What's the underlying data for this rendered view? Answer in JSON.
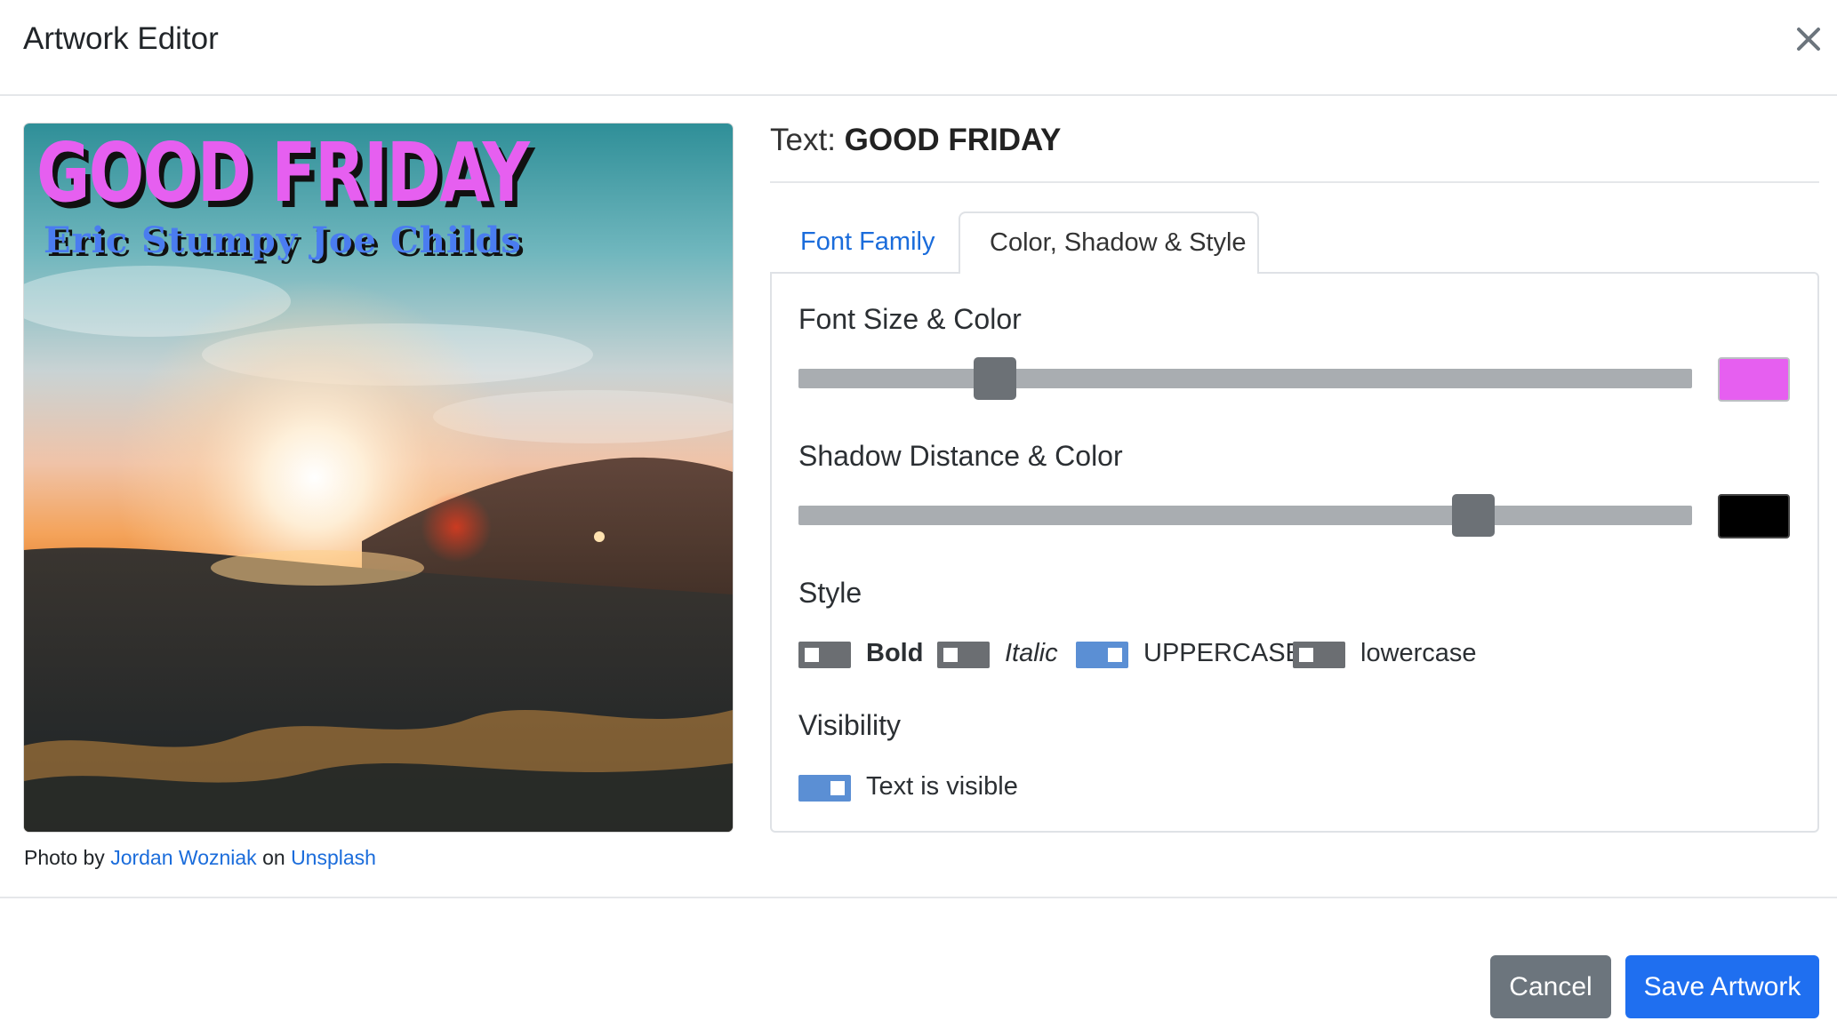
{
  "header": {
    "title": "Artwork Editor",
    "close_icon": "close-icon"
  },
  "artwork": {
    "headline": "GOOD FRIDAY",
    "subtitle": "Eric Stumpy Joe Childs",
    "headline_color": "#e65ff0",
    "subtitle_color": "#4a7cf0",
    "credit": {
      "prefix": "Photo by",
      "author": "Jordan Wozniak",
      "middle": "on",
      "site": "Unsplash"
    }
  },
  "editor": {
    "text_prefix": "Text:",
    "text_value": "GOOD FRIDAY",
    "tabs": [
      {
        "label": "Font Family",
        "active": false
      },
      {
        "label": "Color, Shadow & Style",
        "active": true
      }
    ],
    "font_size": {
      "label": "Font Size & Color",
      "slider_fraction": 0.22,
      "color": "#e65ff0"
    },
    "shadow": {
      "label": "Shadow Distance & Color",
      "slider_fraction": 0.755,
      "color": "#000000"
    },
    "style": {
      "label": "Style",
      "options": [
        {
          "label": "Bold",
          "on": false
        },
        {
          "label": "Italic",
          "on": false
        },
        {
          "label": "UPPERCASE",
          "on": true
        },
        {
          "label": "lowercase",
          "on": false
        }
      ]
    },
    "visibility": {
      "label": "Visibility",
      "toggle_label": "Text is visible",
      "on": true
    }
  },
  "footer": {
    "cancel": "Cancel",
    "save": "Save Artwork"
  },
  "colors": {
    "accent": "#1f6ff0",
    "toggle_on": "#5b8fd4",
    "toggle_off": "#6b6e72"
  }
}
